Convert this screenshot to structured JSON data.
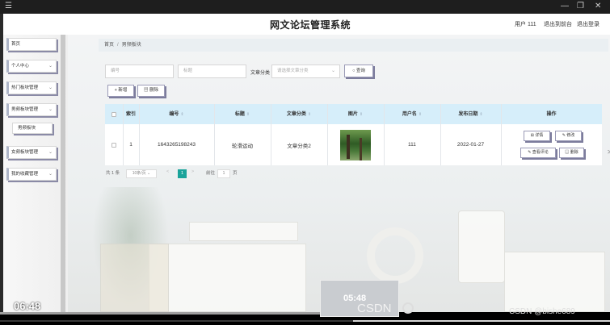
{
  "window": {
    "menu_icon": "hamburger-icon",
    "restore_icon": "restore-icon",
    "close_icon": "close-icon"
  },
  "app": {
    "title": "网文论坛管理系统",
    "user_label": "用户 111",
    "back_to_front": "退出到前台",
    "logout": "退出登录"
  },
  "sidebar": {
    "items": [
      {
        "label": "首页",
        "chevron": ""
      },
      {
        "label": "个人中心",
        "chevron": "⌄"
      },
      {
        "label": "热门板块管理",
        "chevron": "⌄"
      },
      {
        "label": "男频板块管理",
        "chevron": "⌄"
      },
      {
        "label": "男频板块"
      },
      {
        "label": "女频板块管理",
        "chevron": "⌄"
      },
      {
        "label": "我的收藏管理",
        "chevron": "⌄"
      }
    ]
  },
  "breadcrumb": {
    "home": "首页",
    "separator": "/",
    "current": "男频板块"
  },
  "filters": {
    "number_placeholder": "编号",
    "title_placeholder": "标题",
    "category_label": "文章分类",
    "category_placeholder": "请选择文章分类",
    "search_button": "查询"
  },
  "actions": {
    "add_button": "+ 新增",
    "delete_button": "删除"
  },
  "table": {
    "columns": [
      "索引",
      "编号",
      "标题",
      "文章分类",
      "图片",
      "用户名",
      "发布日期",
      "操作"
    ],
    "rows": [
      {
        "index": "1",
        "number": "1643265198243",
        "title": "轮滑运动",
        "category": "文章分类2",
        "username": "111",
        "date": "2022-01-27"
      }
    ],
    "row_actions": {
      "detail": "详情",
      "edit": "修改",
      "view_comments": "查看评论",
      "delete": "删除"
    }
  },
  "pagination": {
    "total": "共 1 条",
    "page_size": "10条/页",
    "prev": "<",
    "current_page": "1",
    "next": ">",
    "goto_prefix": "前往",
    "goto_value": "1",
    "goto_suffix": "页"
  },
  "video": {
    "time": "06:48",
    "preview_time": "05:48",
    "watermark_brand": "CSDN",
    "watermark_user": "CSDN @bishe689",
    "progress": 0.58
  }
}
